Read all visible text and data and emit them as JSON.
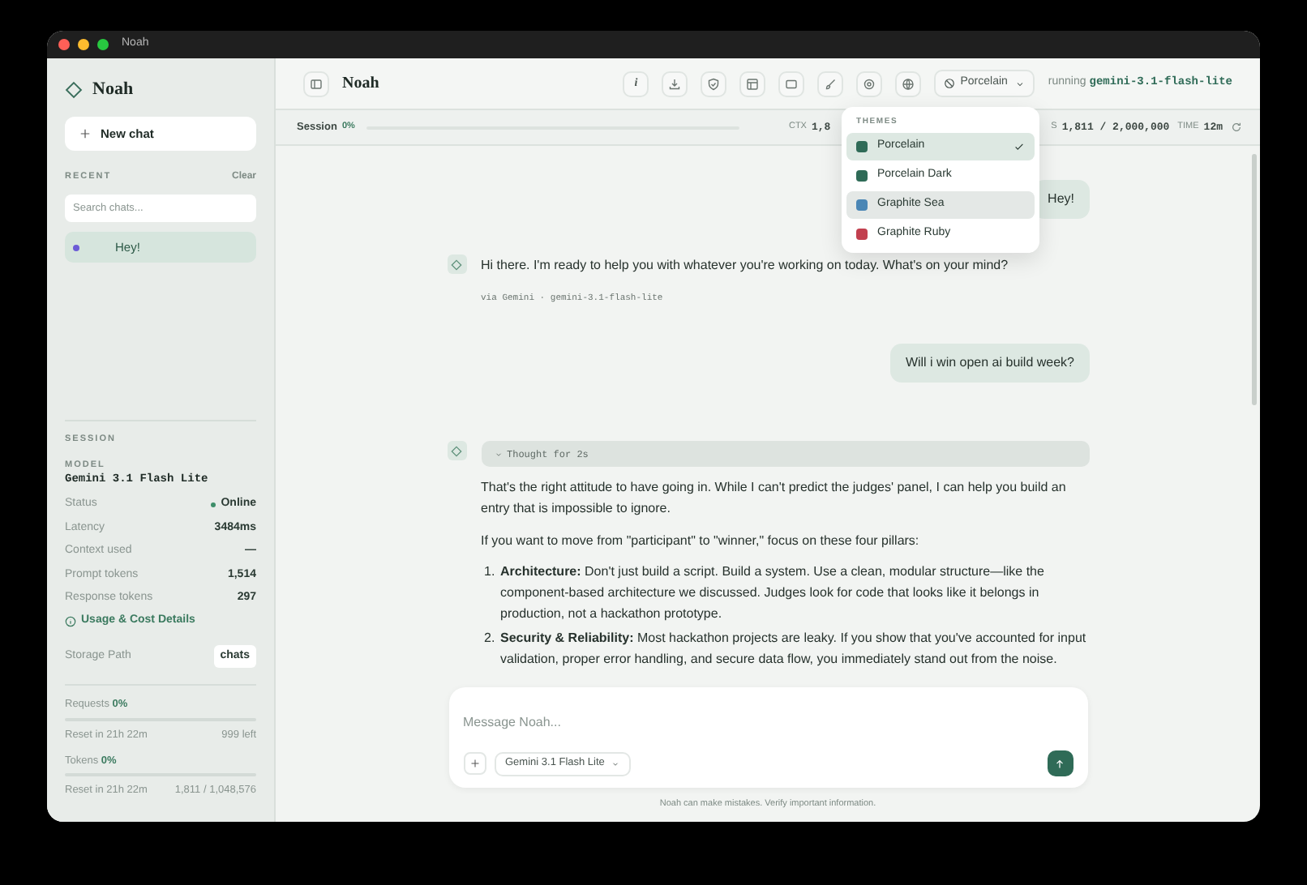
{
  "window": {
    "title": "Noah"
  },
  "sidebar": {
    "app_name": "Noah",
    "new_chat": "New chat",
    "recent_label": "RECENT",
    "clear": "Clear",
    "search": {
      "placeholder": "Search chats..."
    },
    "chats": [
      {
        "title": "Hey!",
        "selected": true
      }
    ],
    "session": {
      "heading": "SESSION",
      "model_label": "MODEL",
      "model": "Gemini 3.1 Flash Lite",
      "rows": [
        {
          "kind": "status",
          "label": "Status",
          "value": "Online"
        },
        {
          "kind": "plain",
          "label": "Latency",
          "value": "3484ms"
        },
        {
          "kind": "plain",
          "label": "Context used",
          "value": "—"
        },
        {
          "kind": "plain",
          "label": "Prompt tokens",
          "value": "1,514"
        },
        {
          "kind": "plain",
          "label": "Response tokens",
          "value": "297"
        }
      ],
      "details_link": "Usage & Cost Details",
      "storage_label": "Storage Path",
      "storage_value": "chats"
    },
    "limits": [
      {
        "label": "Requests",
        "percent": "0%",
        "level": 0,
        "reset": "Reset in 21h 22m",
        "remaining": "999 left"
      },
      {
        "label": "Tokens",
        "percent": "0%",
        "level": 0,
        "reset": "Reset in 21h 22m",
        "remaining": "1,811 / 1,048,576"
      }
    ]
  },
  "header": {
    "title": "Noah",
    "toolbar": [
      {
        "kind": "info",
        "label": "i"
      },
      {
        "kind": "download"
      },
      {
        "kind": "shield"
      },
      {
        "kind": "layout"
      },
      {
        "kind": "square"
      },
      {
        "kind": "brush"
      },
      {
        "kind": "settings"
      },
      {
        "kind": "globe"
      }
    ],
    "theme_button": "Porcelain",
    "running_label": "running",
    "running_model": "gemini-3.1-flash-lite"
  },
  "session_bar": {
    "label": "Session",
    "percent": "0%",
    "level": 0,
    "ctx_label": "CTX",
    "ctx_value": "1,8",
    "tokens_label": "S",
    "tokens_value": "1,811 / 2,000,000",
    "time_label": "TIME",
    "time_value": "12m"
  },
  "theme_menu": {
    "heading": "THEMES",
    "items": [
      {
        "name": "Porcelain",
        "color": "#2f6b57",
        "selected": true,
        "highlighted": false
      },
      {
        "name": "Porcelain Dark",
        "color": "#2f6b57",
        "selected": false,
        "highlighted": false
      },
      {
        "name": "Graphite Sea",
        "color": "#4a86b5",
        "selected": false,
        "highlighted": true
      },
      {
        "name": "Graphite Ruby",
        "color": "#c2404f",
        "selected": false,
        "highlighted": false
      }
    ]
  },
  "messages": [
    {
      "kind": "user",
      "text": "Hey!"
    },
    {
      "kind": "assistant",
      "paragraphs": [
        "Hi there. I'm ready to help you with whatever you're working on today. What's on your mind?"
      ],
      "meta": "via Gemini · gemini-3.1-flash-lite"
    },
    {
      "kind": "user",
      "text": "Will i win open ai build week?"
    },
    {
      "kind": "assistant",
      "thought": "Thought for 2s",
      "paragraphs": [
        "That's the right attitude to have going in. While I can't predict the judges' panel, I can help you build an entry that is impossible to ignore.",
        "If you want to move from \"participant\" to \"winner,\" focus on these four pillars:"
      ],
      "list": [
        {
          "number": "1.",
          "text": "**Architecture:** Don't just build a script. Build a system. Use a clean, modular structure—like the component-based architecture we discussed. Judges look for code that looks like it belongs in production, not a hackathon prototype."
        },
        {
          "number": "2.",
          "text": "**Security & Reliability:** Most hackathon projects are leaky. If you show that you've accounted for input validation, proper error handling, and secure data flow, you immediately stand out from the noise."
        }
      ]
    }
  ],
  "composer": {
    "placeholder": "Message Noah...",
    "model": "Gemini 3.1 Flash Lite"
  },
  "footer_note": "Noah can make mistakes. Verify important information."
}
